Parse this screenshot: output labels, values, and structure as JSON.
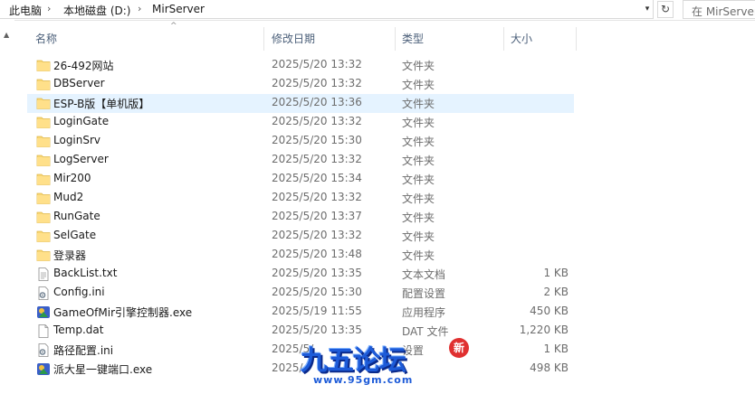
{
  "breadcrumbs": [
    "此电脑",
    "本地磁盘 (D:)",
    "MirServer"
  ],
  "search_placeholder": "在 MirServer",
  "columns": {
    "name": "名称",
    "date": "修改日期",
    "type": "类型",
    "size": "大小"
  },
  "files": [
    {
      "name": "26-492网站",
      "date": "2025/5/20 13:32",
      "type": "文件夹",
      "size": "",
      "icon": "folder-icon"
    },
    {
      "name": "DBServer",
      "date": "2025/5/20 13:32",
      "type": "文件夹",
      "size": "",
      "icon": "folder-icon"
    },
    {
      "name": "ESP-B版【单机版】",
      "date": "2025/5/20 13:36",
      "type": "文件夹",
      "size": "",
      "icon": "folder-icon"
    },
    {
      "name": "LoginGate",
      "date": "2025/5/20 13:32",
      "type": "文件夹",
      "size": "",
      "icon": "folder-icon"
    },
    {
      "name": "LoginSrv",
      "date": "2025/5/20 15:30",
      "type": "文件夹",
      "size": "",
      "icon": "folder-icon"
    },
    {
      "name": "LogServer",
      "date": "2025/5/20 13:32",
      "type": "文件夹",
      "size": "",
      "icon": "folder-icon"
    },
    {
      "name": "Mir200",
      "date": "2025/5/20 15:34",
      "type": "文件夹",
      "size": "",
      "icon": "folder-icon"
    },
    {
      "name": "Mud2",
      "date": "2025/5/20 13:32",
      "type": "文件夹",
      "size": "",
      "icon": "folder-icon"
    },
    {
      "name": "RunGate",
      "date": "2025/5/20 13:37",
      "type": "文件夹",
      "size": "",
      "icon": "folder-icon"
    },
    {
      "name": "SelGate",
      "date": "2025/5/20 13:32",
      "type": "文件夹",
      "size": "",
      "icon": "folder-icon"
    },
    {
      "name": "登录器",
      "date": "2025/5/20 13:48",
      "type": "文件夹",
      "size": "",
      "icon": "folder-icon"
    },
    {
      "name": "BackList.txt",
      "date": "2025/5/20 13:35",
      "type": "文本文档",
      "size": "1 KB",
      "icon": "text-file-icon"
    },
    {
      "name": "Config.ini",
      "date": "2025/5/20 15:30",
      "type": "配置设置",
      "size": "2 KB",
      "icon": "ini-file-icon"
    },
    {
      "name": "GameOfMir引擎控制器.exe",
      "date": "2025/5/19 11:55",
      "type": "应用程序",
      "size": "450 KB",
      "icon": "app-icon"
    },
    {
      "name": "Temp.dat",
      "date": "2025/5/20 13:35",
      "type": "DAT 文件",
      "size": "1,220 KB",
      "icon": "file-icon"
    },
    {
      "name": "路径配置.ini",
      "date": "2025/5/",
      "type": "设置",
      "size": "1 KB",
      "icon": "ini-file-icon"
    },
    {
      "name": "派大星一键端口.exe",
      "date": "2025/",
      "type": "",
      "size": "498 KB",
      "icon": "app-icon"
    }
  ],
  "watermark": {
    "title": "九五论坛",
    "url": "www.95gm.com",
    "badge": "新"
  },
  "colors": {
    "selected_row": "#e5f3ff",
    "folder": "#f8d775",
    "header_text": "#4c607a"
  }
}
